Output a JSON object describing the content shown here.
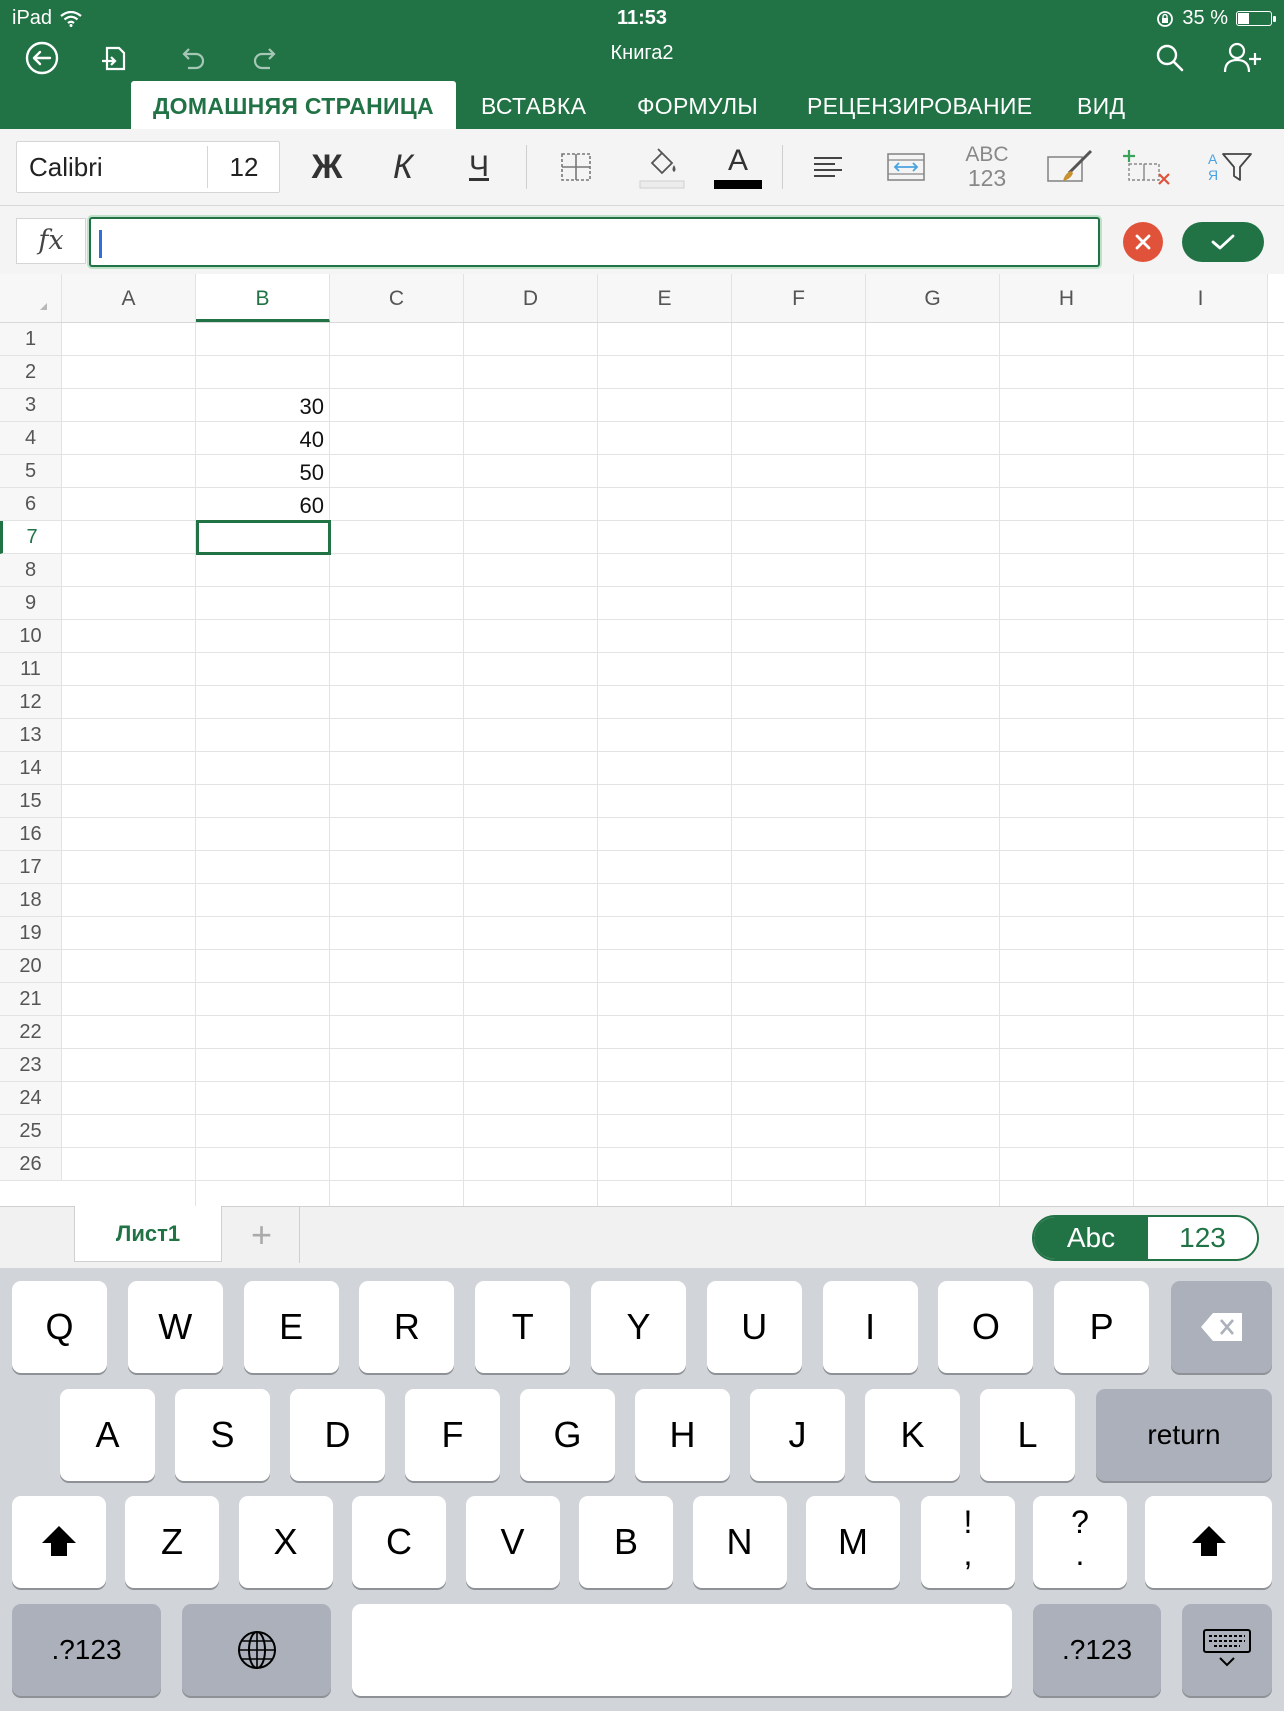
{
  "status": {
    "device": "iPad",
    "time": "11:53",
    "battery": "35 %",
    "battery_level": 0.35
  },
  "header": {
    "title": "Книга2",
    "icons": [
      "back-arrow-icon",
      "share-file-icon",
      "undo-icon",
      "redo-icon",
      "search-icon",
      "add-person-icon"
    ]
  },
  "tabs": [
    "ДОМАШНЯЯ СТРАНИЦА",
    "ВСТАВКА",
    "ФОРМУЛЫ",
    "РЕЦЕНЗИРОВАНИЕ",
    "ВИД"
  ],
  "active_tab": "ДОМАШНЯЯ СТРАНИЦА",
  "ribbon": {
    "font_name": "Calibri",
    "font_size": "12",
    "bold_label": "Ж",
    "italic_label": "К",
    "underline_label": "Ч",
    "font_color_label": "A",
    "number_format_top": "ABC",
    "number_format_bottom": "123",
    "sort_top": "А",
    "sort_bottom": "Я"
  },
  "formula_bar": {
    "fx_label": "fx",
    "value": ""
  },
  "grid": {
    "columns": [
      "A",
      "B",
      "C",
      "D",
      "E",
      "F",
      "G",
      "H",
      "I"
    ],
    "selected_column": "B",
    "rows": [
      "1",
      "2",
      "3",
      "4",
      "5",
      "6",
      "7",
      "8",
      "9",
      "10",
      "11",
      "12",
      "13",
      "14",
      "15",
      "16",
      "17",
      "18",
      "19",
      "20",
      "21",
      "22",
      "23",
      "24",
      "25",
      "26"
    ],
    "selected_row": "7",
    "cells": [
      {
        "ref": "B3",
        "value": "30"
      },
      {
        "ref": "B4",
        "value": "40"
      },
      {
        "ref": "B5",
        "value": "50"
      },
      {
        "ref": "B6",
        "value": "60"
      }
    ],
    "active_cell": "B7"
  },
  "sheets": {
    "tabs": [
      "Лист1"
    ],
    "add_label": "+"
  },
  "input_toggle": {
    "abc": "Abc",
    "num": "123",
    "selected": "Abc"
  },
  "keyboard": {
    "row1": [
      "Q",
      "W",
      "E",
      "R",
      "T",
      "Y",
      "U",
      "I",
      "O",
      "P"
    ],
    "row2": [
      "A",
      "S",
      "D",
      "F",
      "G",
      "H",
      "J",
      "K",
      "L"
    ],
    "return_label": "return",
    "row3": [
      "Z",
      "X",
      "C",
      "V",
      "B",
      "N",
      "M"
    ],
    "punct1_top": "!",
    "punct1_bottom": ",",
    "punct2_top": "?",
    "punct2_bottom": ".",
    "numbers_label": ".?123"
  },
  "colors": {
    "accent": "#217346",
    "cancel": "#e0533a",
    "caret": "#2f6fd6"
  }
}
